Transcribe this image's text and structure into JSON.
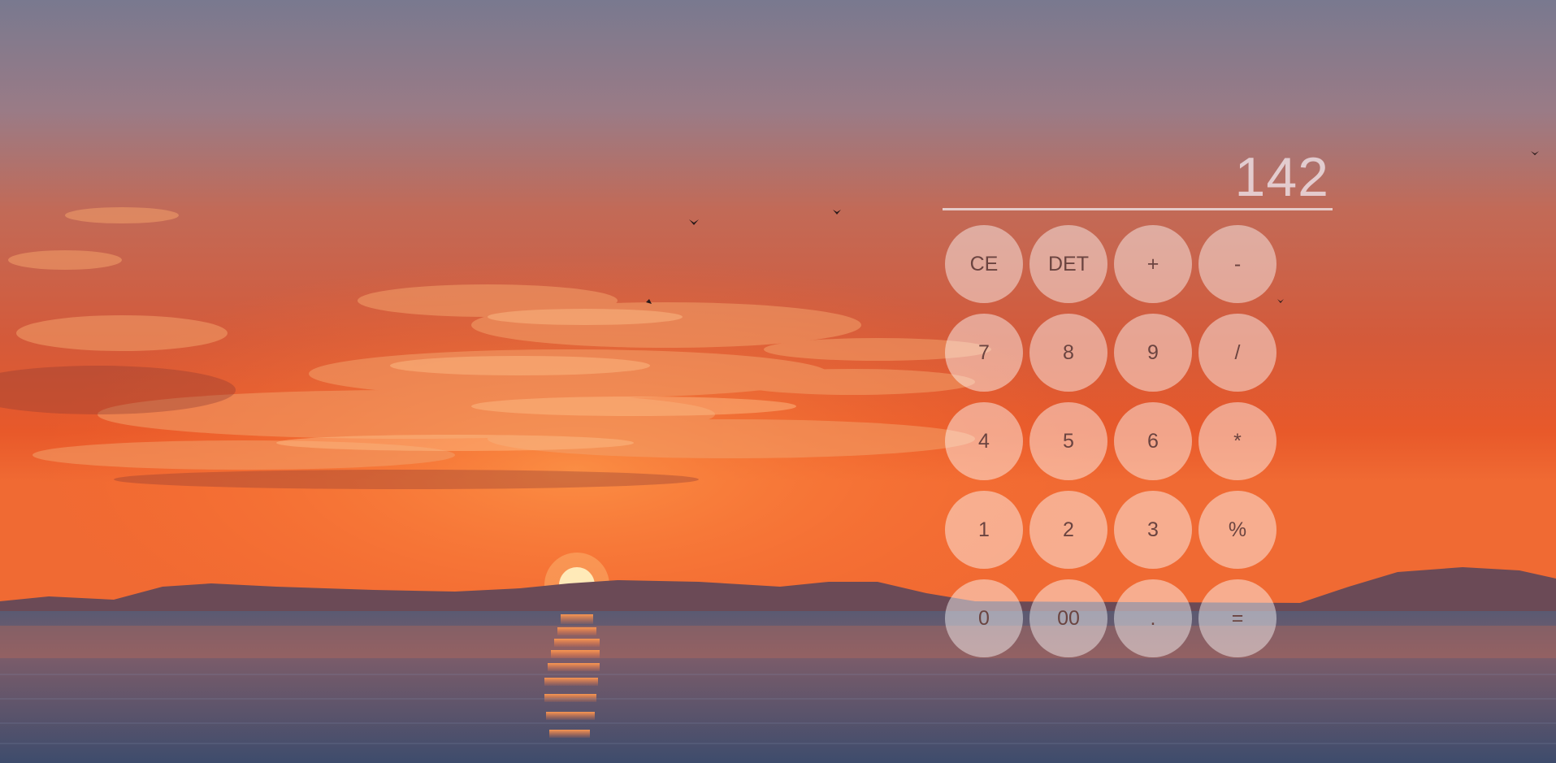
{
  "display": {
    "value": "142"
  },
  "keys": [
    {
      "label": "CE",
      "name": "clear-entry-button"
    },
    {
      "label": "DET",
      "name": "det-button"
    },
    {
      "label": "+",
      "name": "plus-button"
    },
    {
      "label": "-",
      "name": "minus-button"
    },
    {
      "label": "7",
      "name": "digit-7-button"
    },
    {
      "label": "8",
      "name": "digit-8-button"
    },
    {
      "label": "9",
      "name": "digit-9-button"
    },
    {
      "label": "/",
      "name": "divide-button"
    },
    {
      "label": "4",
      "name": "digit-4-button"
    },
    {
      "label": "5",
      "name": "digit-5-button"
    },
    {
      "label": "6",
      "name": "digit-6-button"
    },
    {
      "label": "*",
      "name": "multiply-button"
    },
    {
      "label": "1",
      "name": "digit-1-button"
    },
    {
      "label": "2",
      "name": "digit-2-button"
    },
    {
      "label": "3",
      "name": "digit-3-button"
    },
    {
      "label": "%",
      "name": "percent-button"
    },
    {
      "label": "0",
      "name": "digit-0-button"
    },
    {
      "label": "00",
      "name": "double-zero-button"
    },
    {
      "label": ".",
      "name": "decimal-point-button"
    },
    {
      "label": "=",
      "name": "equals-button"
    }
  ],
  "colors": {
    "sky_top": "#7a7b93",
    "sky_mid": "#c8614a",
    "horizon": "#ef5a25",
    "sun": "#fff6d0",
    "sea": "#4e5a78"
  }
}
